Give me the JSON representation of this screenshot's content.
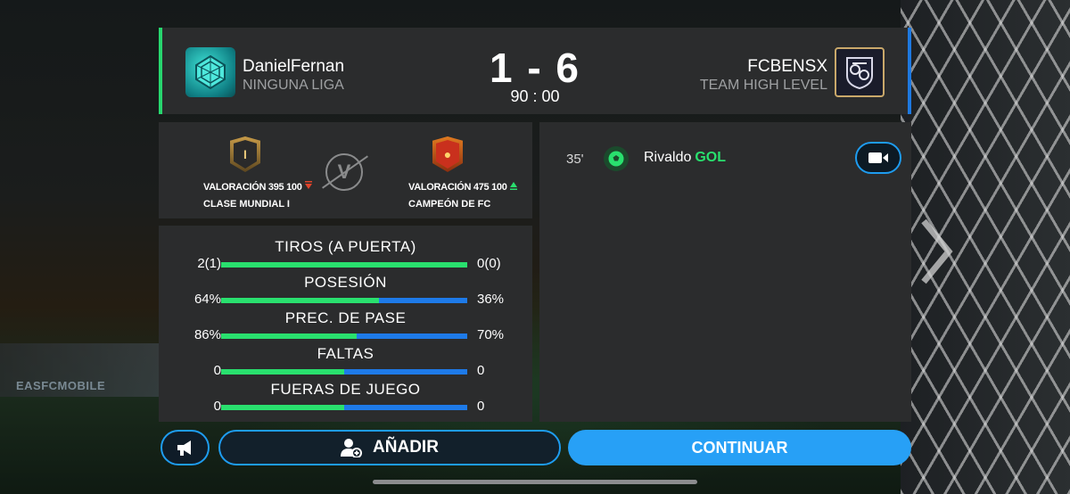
{
  "match": {
    "home": {
      "name": "DanielFernan",
      "league": "NINGUNA LIGA"
    },
    "away": {
      "name": "FCBENSX",
      "league": "TEAM HIGH LEVEL"
    },
    "score": "1 - 6",
    "time": "90 : 00"
  },
  "ratings": {
    "home": {
      "rating": "VALORACIÓN 395 100",
      "trend": "down",
      "rank": "CLASE MUNDIAL I",
      "badge": "I"
    },
    "away": {
      "rating": "VALORACIÓN 475 100",
      "trend": "up",
      "rank": "CAMPEÓN DE FC"
    },
    "vs_label": "V"
  },
  "stats": [
    {
      "title": "TIROS (A PUERTA)",
      "left": "2(1)",
      "right": "0(0)",
      "home_share": 1.0
    },
    {
      "title": "POSESIÓN",
      "left": "64%",
      "right": "36%",
      "home_share": 0.64
    },
    {
      "title": "PREC. DE PASE",
      "left": "86%",
      "right": "70%",
      "home_share": 0.55
    },
    {
      "title": "FALTAS",
      "left": "0",
      "right": "0",
      "home_share": 0.5
    },
    {
      "title": "FUERAS DE JUEGO",
      "left": "0",
      "right": "0",
      "home_share": 0.5
    }
  ],
  "events": [
    {
      "minute": "35'",
      "player": "Rivaldo",
      "type": "GOL",
      "icon": "soccer-ball-icon"
    }
  ],
  "buttons": {
    "announce_icon": "megaphone-icon",
    "add_label": "AÑADIR",
    "add_icon": "add-friend-icon",
    "continue_label": "CONTINUAR",
    "video_icon": "video-camera-icon"
  },
  "background": {
    "banner_text": "EASFCMOBILE"
  },
  "colors": {
    "home_accent": "#29e06e",
    "away_accent": "#1e7ae8",
    "button_blue": "#27a0f6"
  }
}
